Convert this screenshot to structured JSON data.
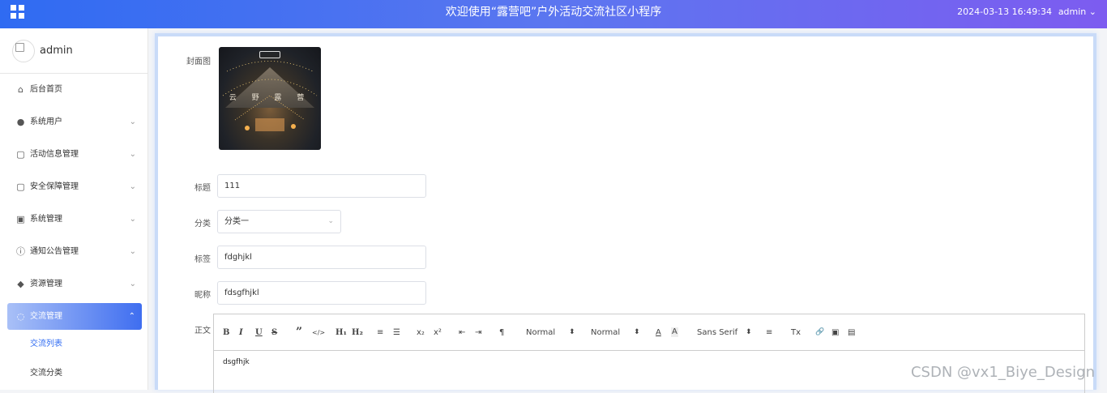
{
  "header": {
    "title": "欢迎使用“露营吧”户外活动交流社区小程序",
    "datetime": "2024-03-13 16:49:34",
    "user": "admin",
    "user_chevron": "⌄"
  },
  "sidebar": {
    "username": "admin",
    "items": [
      {
        "label": "后台首页",
        "icon": "home-icon",
        "glyph": "⌂"
      },
      {
        "label": "系统用户",
        "icon": "user-icon",
        "glyph": "●",
        "chevron": "⌄"
      },
      {
        "label": "活动信息管理",
        "icon": "doc-icon",
        "glyph": "▢",
        "chevron": "⌄"
      },
      {
        "label": "安全保障管理",
        "icon": "doc-icon",
        "glyph": "▢",
        "chevron": "⌄"
      },
      {
        "label": "系统管理",
        "icon": "image-icon",
        "glyph": "▣",
        "chevron": "⌄"
      },
      {
        "label": "通知公告管理",
        "icon": "info-icon",
        "glyph": "ⓘ",
        "chevron": "⌄"
      },
      {
        "label": "资源管理",
        "icon": "pin-icon",
        "glyph": "◆",
        "chevron": "⌄"
      },
      {
        "label": "交流管理",
        "icon": "chat-icon",
        "glyph": "◌",
        "chevron": "⌃"
      }
    ],
    "sub_items": [
      "交流列表",
      "交流分类"
    ]
  },
  "form": {
    "cover_label": "封面图",
    "cover_text": "云 野 露 营",
    "title_label": "标题",
    "title_value": "111",
    "category_label": "分类",
    "category_value": "分类一",
    "tag_label": "标签",
    "tag_value": "fdghjkl",
    "nickname_label": "昵称",
    "nickname_value": "fdsgfhjkl",
    "content_label": "正文",
    "content_value": "dsgfhjk"
  },
  "toolbar": {
    "bold": "B",
    "italic": "I",
    "underline": "U",
    "strike": "S",
    "quote": "”",
    "code": "</>",
    "h1": "H₁",
    "h2": "H₂",
    "ordered": "≡",
    "bullet": "☰",
    "sub": "x₂",
    "sup": "x²",
    "outdent": "⇤",
    "indent": "⇥",
    "direction": "¶",
    "size": "Normal",
    "header": "Normal",
    "color": "A",
    "background": "A",
    "font": "Sans Serif",
    "align": "≡",
    "clean": "Tx",
    "link": "🔗",
    "image": "▣",
    "video": "▤",
    "updown": "⬍"
  },
  "watermark": "CSDN @vx1_Biye_Design"
}
